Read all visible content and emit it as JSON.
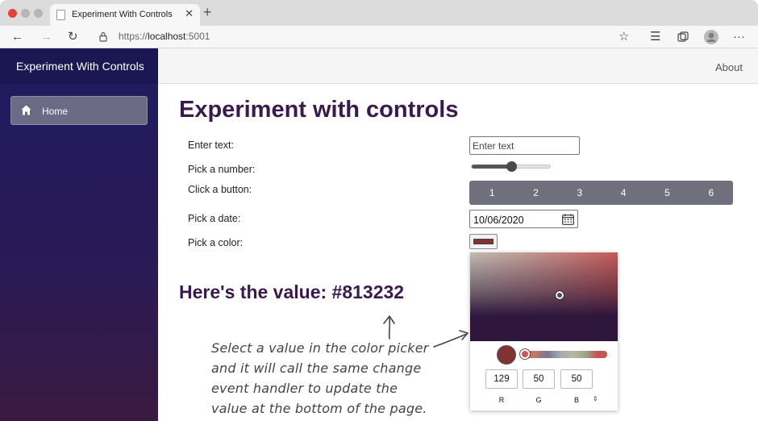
{
  "browser": {
    "tab_title": "Experiment With Controls",
    "tab_close": "✕",
    "new_tab": "+",
    "url_scheme": "https://",
    "url_host": "localhost",
    "url_port": ":5001",
    "nav_back": "←",
    "nav_forward": "→",
    "reload": "↻",
    "favorite": "☆",
    "favorites_list": "☰",
    "more": "···"
  },
  "sidebar": {
    "brand": "Experiment With Controls",
    "items": [
      {
        "label": "Home",
        "icon": "home-icon"
      }
    ]
  },
  "top_row": {
    "about": "About"
  },
  "main": {
    "title": "Experiment with controls",
    "labels": {
      "text": "Enter text:",
      "number": "Pick a number:",
      "button": "Click a button:",
      "date": "Pick a date:",
      "color": "Pick a color:"
    },
    "text_input": {
      "placeholder": "Enter text",
      "value": ""
    },
    "slider": {
      "min": 0,
      "max": 100,
      "value": 50
    },
    "buttons": [
      "1",
      "2",
      "3",
      "4",
      "5",
      "6"
    ],
    "date_value": "10/06/2020",
    "color_value": "#813232",
    "value_heading": "Here's the value: #813232"
  },
  "color_picker": {
    "r": "129",
    "g": "50",
    "b": "50",
    "r_label": "R",
    "g_label": "G",
    "b_label": "B",
    "mode_toggle": "⇕"
  },
  "annotation": {
    "lines": [
      "Select a value in the color picker",
      "and it will call the same change",
      "event handler to update the",
      "value at the bottom of the page."
    ]
  },
  "colors": {
    "sidebar": "#1f1b61",
    "heading": "#3a1a4c",
    "button_group": "#70707c",
    "selected_color": "#813232"
  }
}
